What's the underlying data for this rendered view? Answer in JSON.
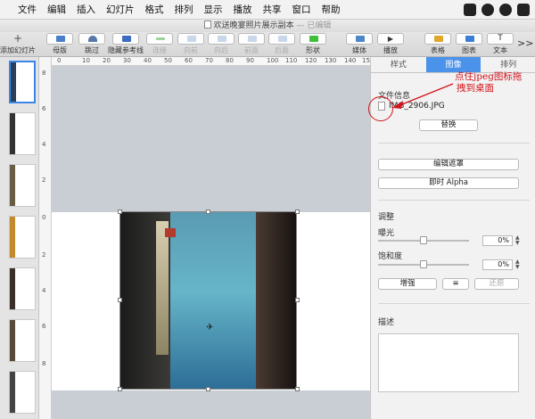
{
  "menubar": {
    "items": [
      "文件",
      "编辑",
      "插入",
      "幻灯片",
      "格式",
      "排列",
      "显示",
      "播放",
      "共享",
      "窗口",
      "帮助"
    ],
    "status_icons": [
      "wechat-icon",
      "app-icon",
      "sync-icon",
      "drive-icon"
    ]
  },
  "titlebar": {
    "title": "欢送晚宴照片展示副本",
    "separator": "—",
    "status": "已编辑"
  },
  "toolbar": {
    "add_slide": "添加幻灯片",
    "master": "母版",
    "skip": "跳过",
    "hide_guides": "隐藏参考线",
    "connect": "连接",
    "forward": "向前",
    "backward": "向后",
    "front": "前面",
    "back": "后面",
    "shape": "形状",
    "media": "媒体",
    "play": "播放",
    "table": "表格",
    "chart": "图表",
    "text": "文本",
    "more": ">>"
  },
  "hruler": {
    "ticks": [
      "0",
      "10",
      "20",
      "30",
      "40",
      "50",
      "60",
      "70",
      "80",
      "90",
      "100",
      "110",
      "120",
      "130",
      "140",
      "150"
    ]
  },
  "vruler": {
    "ticks": [
      "8",
      "6",
      "4",
      "2",
      "0",
      "2",
      "4",
      "6",
      "8"
    ]
  },
  "inspector": {
    "tabs": [
      "样式",
      "图像",
      "排列"
    ],
    "file_info_label": "文件信息",
    "file_name": "IMG_2906.JPG",
    "replace_button": "替换",
    "edit_mask_button": "编辑遮罩",
    "instant_alpha_button": "即时 Alpha",
    "adjust_label": "调整",
    "exposure_label": "曝光",
    "exposure_value": "0%",
    "saturation_label": "饱和度",
    "saturation_value": "0%",
    "enhance_button": "增强",
    "settings_glyph": "≡",
    "reset_button": "还原",
    "description_label": "描述",
    "description_text": ""
  },
  "annotation": {
    "line1": "点住jpeg图标拖",
    "line2": "拽到桌面",
    "color": "#d3121a"
  },
  "colors": {
    "accent": "#4a92ea",
    "selection": "#3a86e8"
  }
}
